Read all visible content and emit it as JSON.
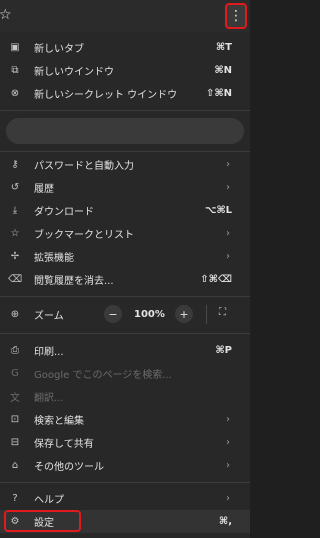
{
  "toolbar": {
    "star_icon": "star-outline-icon",
    "menu_icon": "kebab-menu-icon",
    "highlight_color": "#e11b1b"
  },
  "menu": {
    "new_tab": {
      "label": "新しいタブ",
      "shortcut": "⌘T"
    },
    "new_window": {
      "label": "新しいウインドウ",
      "shortcut": "⌘N"
    },
    "new_incognito": {
      "label": "新しいシークレット ウインドウ",
      "shortcut": "⇧⌘N"
    },
    "passwords": {
      "label": "パスワードと自動入力"
    },
    "history": {
      "label": "履歴"
    },
    "downloads": {
      "label": "ダウンロード",
      "shortcut": "⌥⌘L"
    },
    "bookmarks": {
      "label": "ブックマークとリスト"
    },
    "extensions": {
      "label": "拡張機能"
    },
    "clear_data": {
      "label": "閲覧履歴を消去...",
      "shortcut": "⇧⌘⌫"
    },
    "zoom": {
      "label": "ズーム",
      "minus": "−",
      "value": "100%",
      "plus": "+",
      "fullscreen": "⛶"
    },
    "print": {
      "label": "印刷...",
      "shortcut": "⌘P"
    },
    "google_search": {
      "label": "Google でこのページを検索..."
    },
    "translate": {
      "label": "翻訳..."
    },
    "find_edit": {
      "label": "検索と編集"
    },
    "save_share": {
      "label": "保存して共有"
    },
    "more_tools": {
      "label": "その他のツール"
    },
    "help": {
      "label": "ヘルプ"
    },
    "settings": {
      "label": "設定",
      "shortcut": "⌘,"
    }
  }
}
